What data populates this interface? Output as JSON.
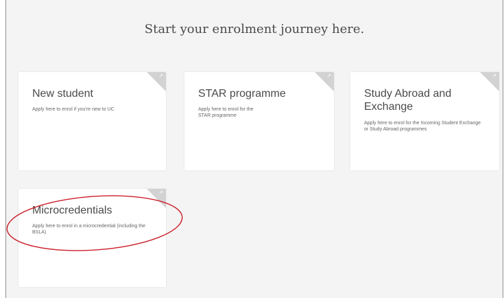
{
  "heading": "Start your enrolment journey here.",
  "cards": [
    {
      "title": "New student",
      "description": "Apply here to enrol if you're new to UC"
    },
    {
      "title": "STAR programme",
      "description": "Apply here to enrol for the STAR programme"
    },
    {
      "title": "Study Abroad and Exchange",
      "description": "Apply here to enrol for the Incoming Student Exchange or Study Abroad programmes"
    },
    {
      "title": "Microcredentials",
      "description": "Apply here to enrol in a microcredential (including the BSLA)"
    }
  ],
  "icons": {
    "card_corner": "corner-arrow-icon"
  },
  "colors": {
    "background": "#f4f4f4",
    "card": "#ffffff",
    "corner": "#d2d2d2",
    "highlight_ellipse": "#cc1f2a"
  }
}
